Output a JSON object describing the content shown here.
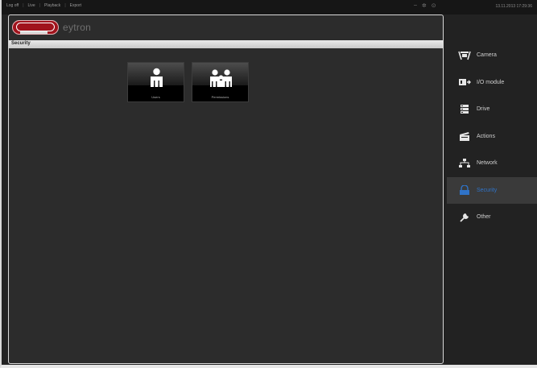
{
  "topbar": {
    "nav": [
      "Live",
      "Playback",
      "Export"
    ],
    "nav_first": "Log off",
    "datetime": "13.11.2013 17:29:36"
  },
  "header": {
    "logo_text": "ABUS",
    "product": "eytron"
  },
  "section": {
    "title": "Security"
  },
  "tiles": [
    {
      "label": "Users",
      "icon": "user-icon"
    },
    {
      "label": "Permissions",
      "icon": "users-group-icon"
    }
  ],
  "sidebar": {
    "items": [
      {
        "label": "Camera",
        "icon": "camera-icon"
      },
      {
        "label": "I/O module",
        "icon": "io-module-icon"
      },
      {
        "label": "Drive",
        "icon": "drive-icon"
      },
      {
        "label": "Actions",
        "icon": "actions-icon"
      },
      {
        "label": "Network",
        "icon": "network-icon"
      },
      {
        "label": "Security",
        "icon": "security-icon",
        "active": true
      },
      {
        "label": "Other",
        "icon": "other-icon"
      }
    ]
  },
  "colors": {
    "brand_red": "#a0131c",
    "active_blue": "#2f73c8",
    "background": "#222222"
  }
}
